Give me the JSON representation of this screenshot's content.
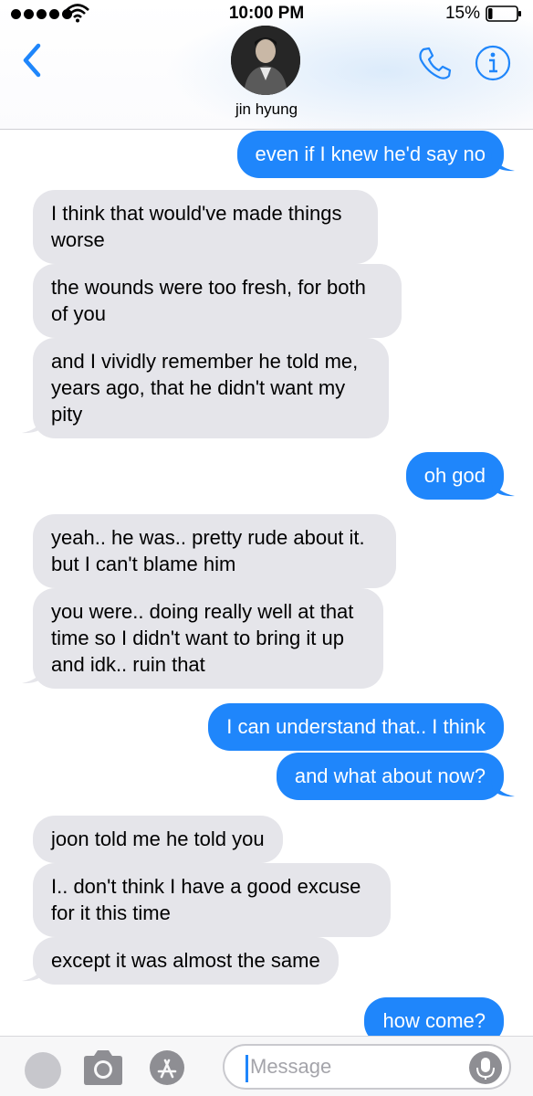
{
  "status_bar": {
    "time": "10:00 PM",
    "battery_percent": "15%",
    "signal_bars": 5,
    "battery_level": 0.15
  },
  "header": {
    "contact_name": "jin hyung",
    "icons": [
      "chevron-left-icon",
      "phone-icon",
      "info-icon"
    ]
  },
  "messages": [
    {
      "dir": "out",
      "text": "even if I knew he'd say no"
    },
    {
      "dir": "in",
      "text": "I think that would've made things\nworse"
    },
    {
      "dir": "in",
      "text": "the wounds were too fresh, for both\nof you"
    },
    {
      "dir": "in",
      "text": "and I vividly remember he told me,\nyears ago, that he didn't want my\npity"
    },
    {
      "dir": "out",
      "text": "oh god"
    },
    {
      "dir": "in",
      "text": "yeah.. he was.. pretty rude about it.\nbut I can't blame him"
    },
    {
      "dir": "in",
      "text": "you were.. doing really well at that\ntime so I didn't want to bring it up\nand idk.. ruin that"
    },
    {
      "dir": "out",
      "text": "I can understand that.. I think"
    },
    {
      "dir": "out",
      "text": "and what about now?"
    },
    {
      "dir": "in",
      "text": "joon told me he told you"
    },
    {
      "dir": "in",
      "text": "I.. don't think I have a good excuse\nfor it this time"
    },
    {
      "dir": "in",
      "text": "except it was almost the same"
    },
    {
      "dir": "out",
      "text": "how come?"
    }
  ],
  "input_bar": {
    "placeholder": "Message",
    "icons": [
      "camera-icon",
      "app-store-icon",
      "microphone-icon"
    ]
  },
  "colors": {
    "outgoing_bubble": "#1f86fb",
    "incoming_bubble": "#e5e5ea",
    "accent": "#1f86fb"
  }
}
